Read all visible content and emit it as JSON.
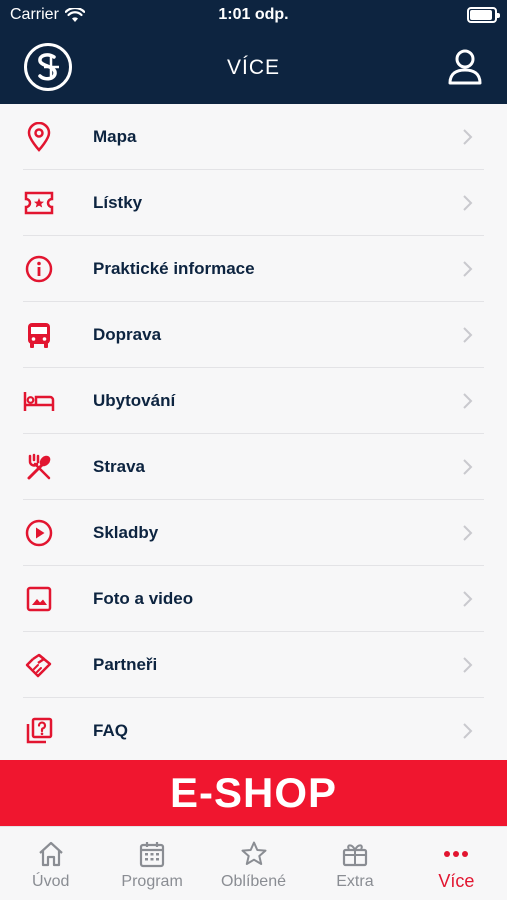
{
  "status_bar": {
    "carrier": "Carrier",
    "time": "1:01 odp."
  },
  "header": {
    "title": "VÍCE",
    "logo": "festival-logo",
    "profile_icon": "user-icon"
  },
  "menu": {
    "items": [
      {
        "label": "Mapa",
        "icon": "map-pin-icon"
      },
      {
        "label": "Lístky",
        "icon": "ticket-icon"
      },
      {
        "label": "Praktické informace",
        "icon": "info-icon"
      },
      {
        "label": "Doprava",
        "icon": "bus-icon"
      },
      {
        "label": "Ubytování",
        "icon": "bed-icon"
      },
      {
        "label": "Strava",
        "icon": "utensils-icon"
      },
      {
        "label": "Skladby",
        "icon": "play-icon"
      },
      {
        "label": "Foto a video",
        "icon": "image-icon"
      },
      {
        "label": "Partneři",
        "icon": "handshake-icon"
      },
      {
        "label": "FAQ",
        "icon": "faq-icon"
      }
    ]
  },
  "banner": {
    "label": "E-SHOP"
  },
  "tabs": [
    {
      "label": "Úvod",
      "icon": "home-icon",
      "active": false
    },
    {
      "label": "Program",
      "icon": "calendar-icon",
      "active": false
    },
    {
      "label": "Oblíbené",
      "icon": "star-icon",
      "active": false
    },
    {
      "label": "Extra",
      "icon": "gift-icon",
      "active": false
    },
    {
      "label": "Více",
      "icon": "more-icon",
      "active": true
    }
  ],
  "colors": {
    "navy": "#0d2440",
    "accent_red": "#f0162f",
    "inactive_gray": "#8a8d93"
  }
}
